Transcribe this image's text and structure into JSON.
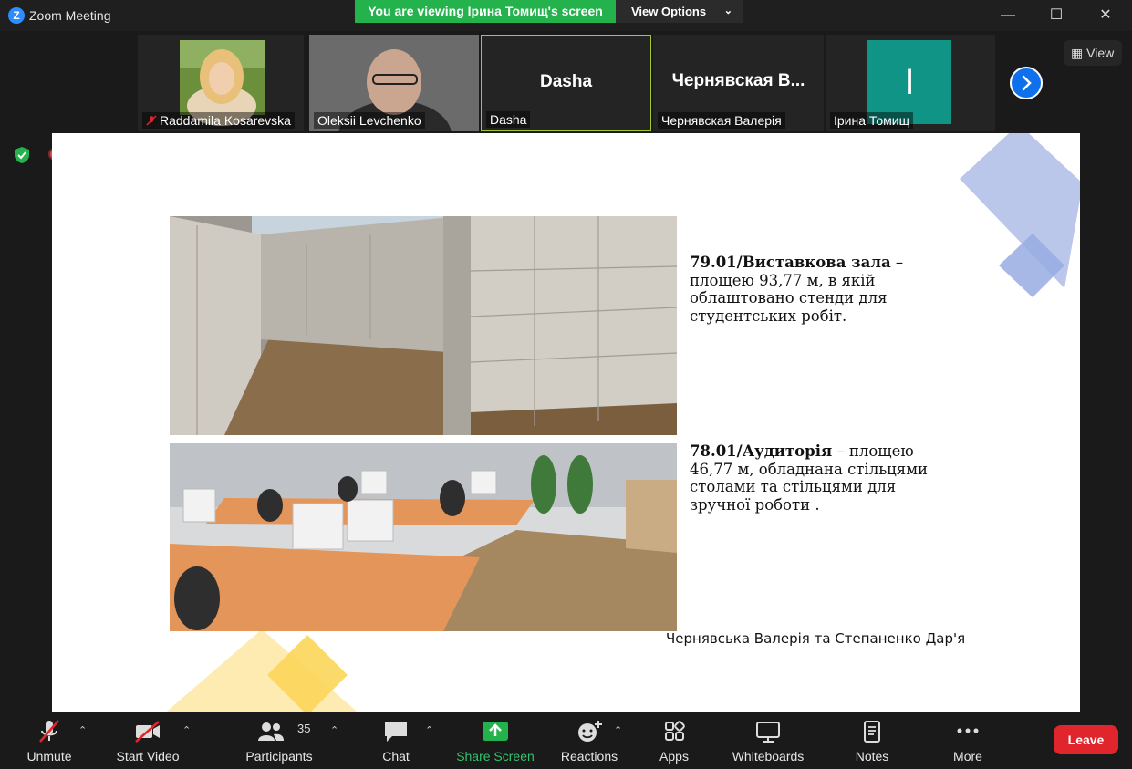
{
  "window": {
    "title": "Zoom Meeting",
    "logo_letter": "Z"
  },
  "banner": {
    "viewing_text": "You are viewing Ірина Томищ's screen",
    "view_options_label": "View Options"
  },
  "participants": [
    {
      "name": "Raddamila Kosarevska",
      "muted": true
    },
    {
      "name": "Oleksii Levchenko"
    },
    {
      "name": "Dasha",
      "display": "Dasha"
    },
    {
      "name": "Чернявская Валерія",
      "display": "Чернявская В..."
    },
    {
      "name": "Ірина Томищ",
      "initial": "І"
    }
  ],
  "view_button_label": "View",
  "slide": {
    "block1": {
      "bold": "79.01/Виставкова зала",
      "rest": " – площею 93,77 м, в якій облаштовано стенди для студентських робіт."
    },
    "block2": {
      "bold": "78.01/Аудиторія",
      "rest": " – площею 46,77 м, обладнана стільцями столами та стільцями для зручної роботи ."
    },
    "authors": "Чернявська Валерія та Степаненко Дар'я"
  },
  "toolbar": {
    "unmute": "Unmute",
    "start_video": "Start Video",
    "participants": "Participants",
    "participants_count": "35",
    "chat": "Chat",
    "share_screen": "Share Screen",
    "reactions": "Reactions",
    "apps": "Apps",
    "whiteboards": "Whiteboards",
    "notes": "Notes",
    "more": "More",
    "leave": "Leave"
  },
  "colors": {
    "banner_green": "#23b24b",
    "leave_red": "#e0252d",
    "avatar_teal": "#0f9485",
    "share_green": "#33c26b",
    "accent_blue": "#0e71eb"
  }
}
